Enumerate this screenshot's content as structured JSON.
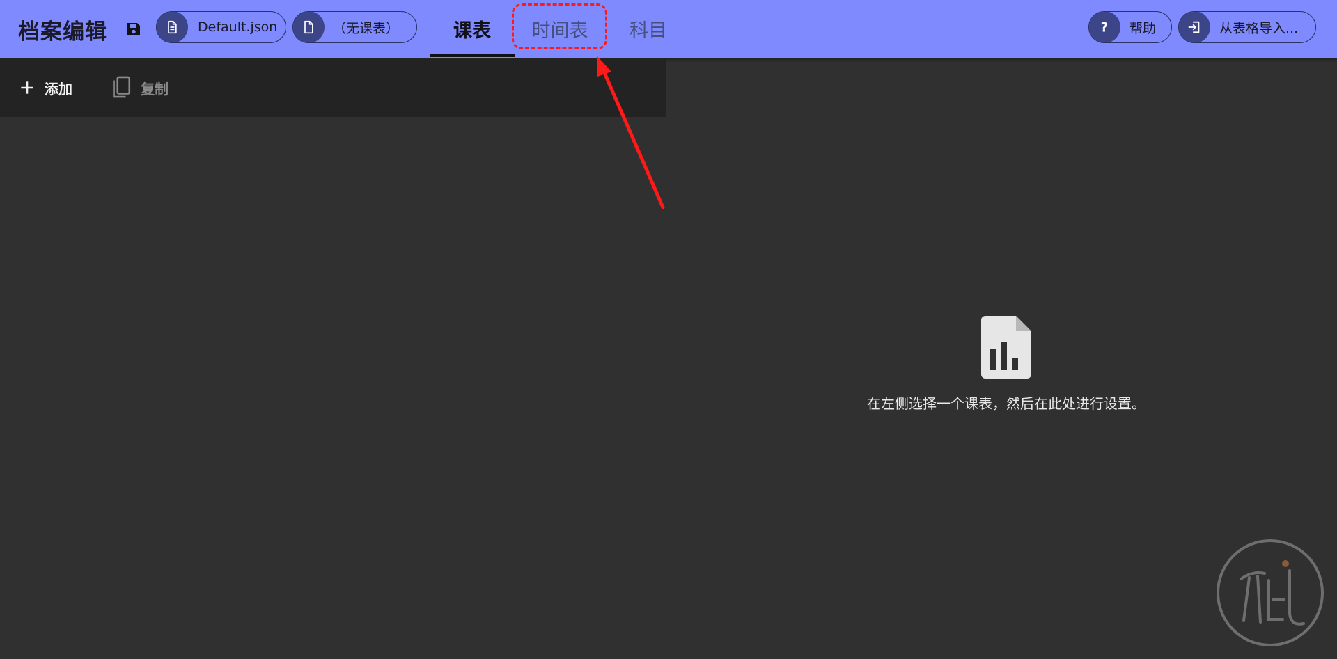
{
  "header": {
    "title": "档案编辑",
    "file_pill": {
      "label": "Default.json",
      "icon": "file-text-icon"
    },
    "schedule_pill": {
      "label": "（无课表）",
      "icon": "file-icon"
    },
    "tabs": [
      {
        "label": "课表",
        "active": true
      },
      {
        "label": "时间表",
        "active": false
      },
      {
        "label": "科目",
        "active": false
      }
    ],
    "help_button": {
      "label": "帮助",
      "icon": "question-icon"
    },
    "import_button": {
      "label": "从表格导入...",
      "icon": "import-icon"
    }
  },
  "toolbar": {
    "add_label": "添加",
    "copy_label": "复制"
  },
  "empty_state": {
    "icon": "chart-file-icon",
    "message": "在左侧选择一个课表，然后在此处进行设置。"
  },
  "colors": {
    "header_bg": "#7f8aff",
    "pill_icon_bg": "#3c4587",
    "toolbar_bg": "#232323",
    "content_bg": "#303030",
    "annotation": "#ff1a1a"
  }
}
